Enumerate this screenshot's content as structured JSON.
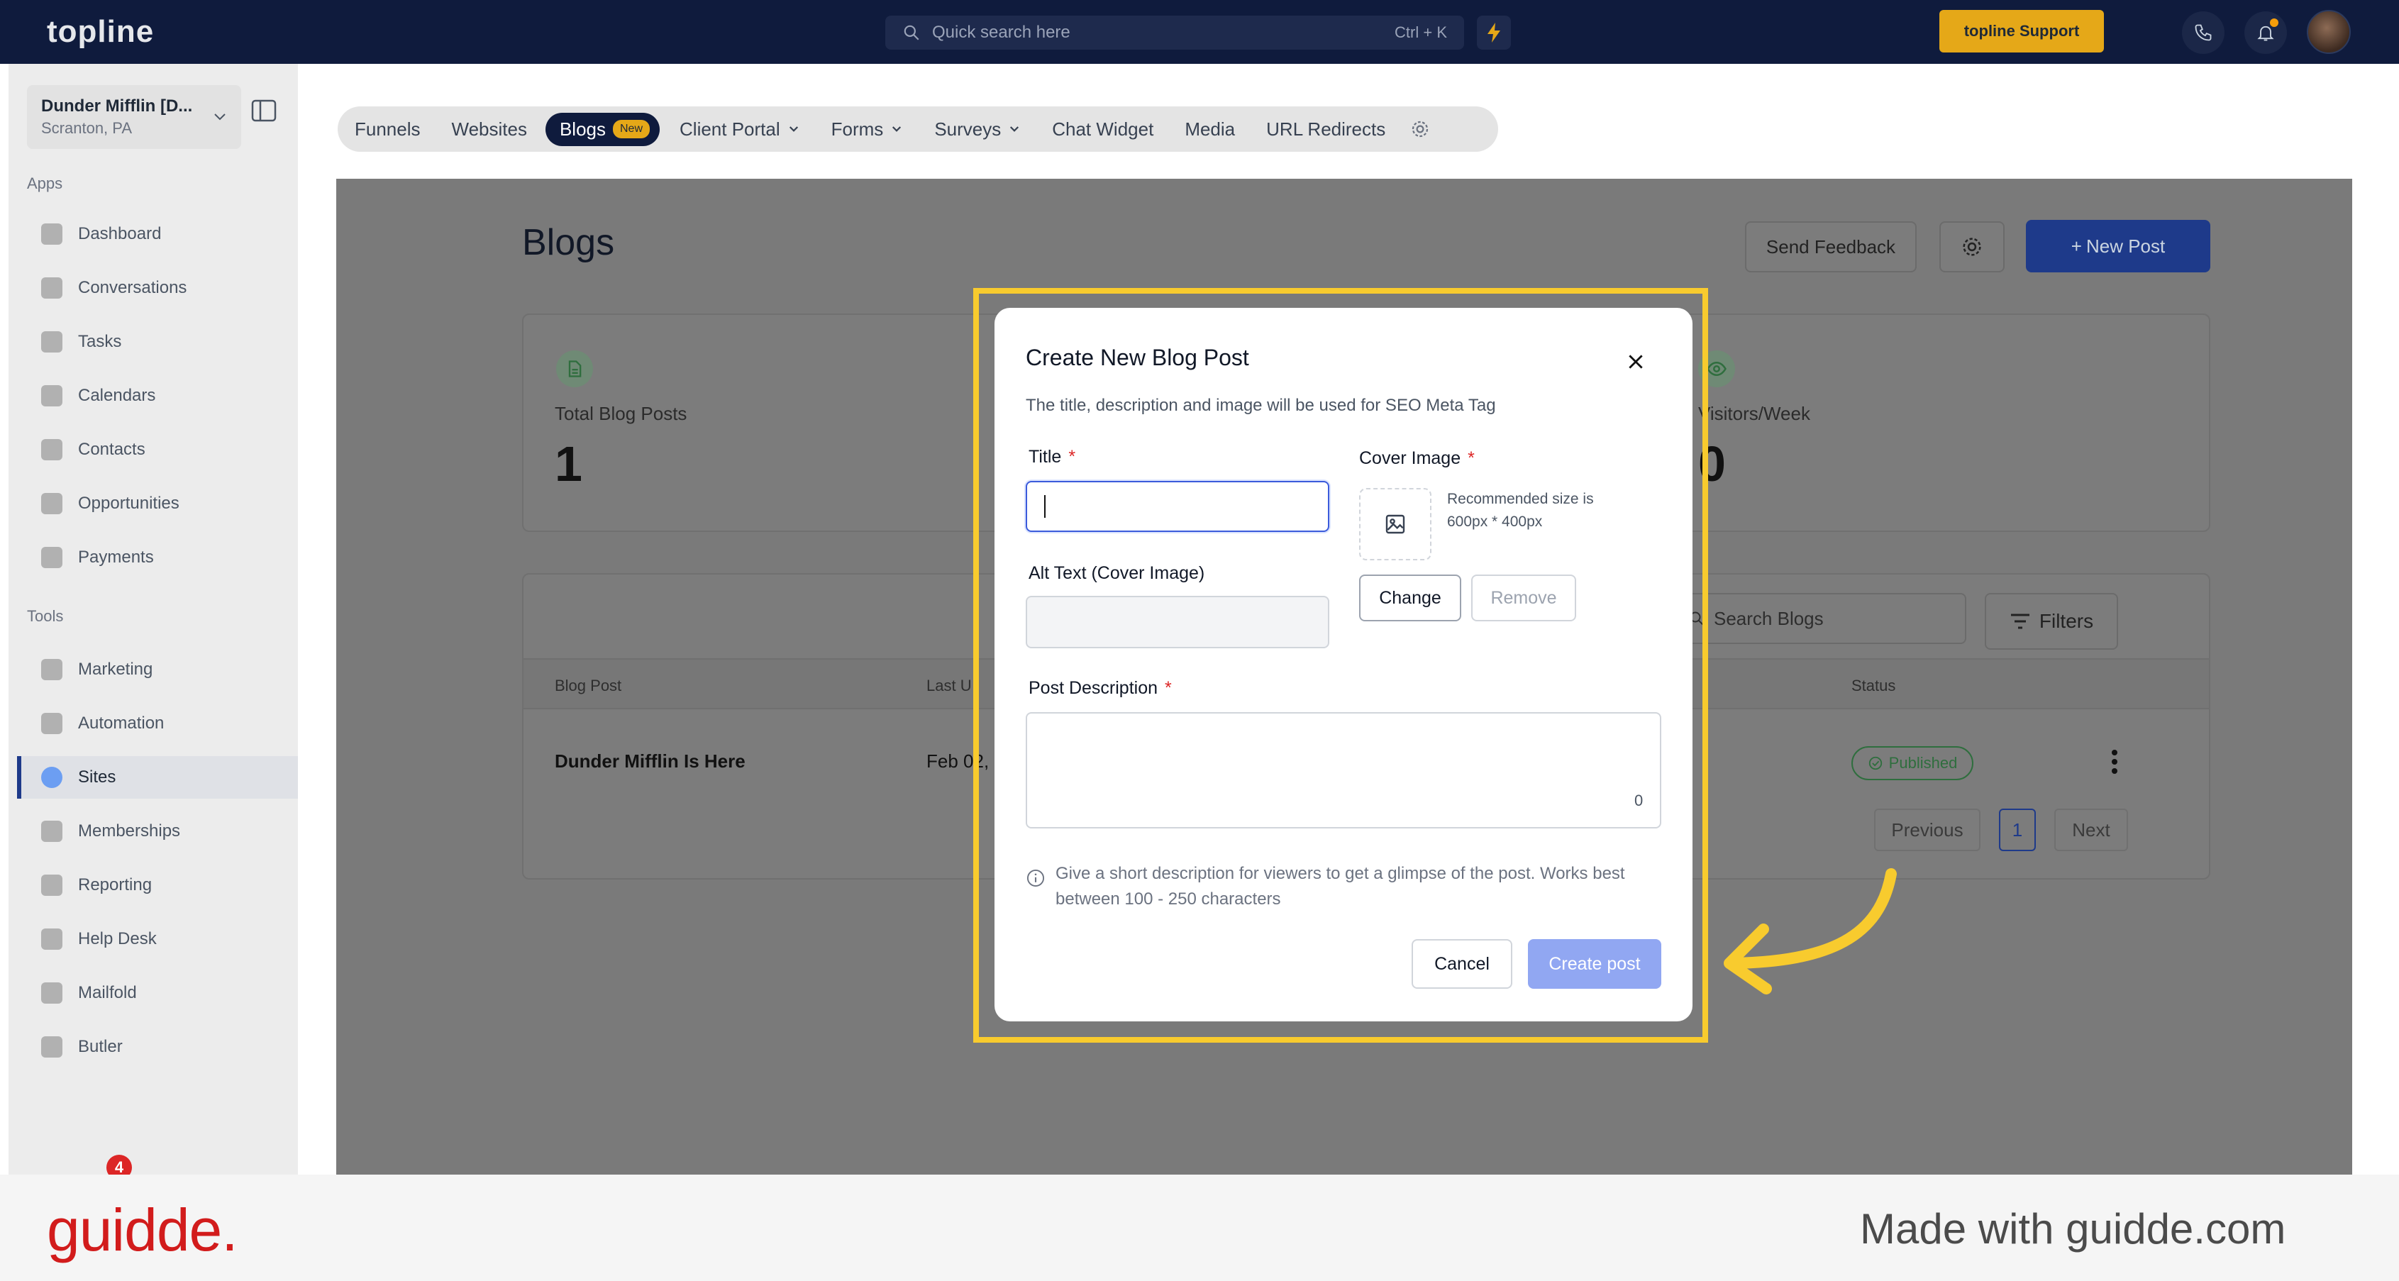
{
  "topbar": {
    "logo": "topline",
    "search_placeholder": "Quick search here",
    "search_shortcut": "Ctrl + K",
    "support_label": "topline Support"
  },
  "sidebar": {
    "location_name": "Dunder Mifflin [D...",
    "location_sub": "Scranton, PA",
    "apps_label": "Apps",
    "apps": [
      "Dashboard",
      "Conversations",
      "Tasks",
      "Calendars",
      "Contacts",
      "Opportunities",
      "Payments"
    ],
    "tools_label": "Tools",
    "tools": [
      "Marketing",
      "Automation",
      "Sites",
      "Memberships",
      "Reporting",
      "Help Desk",
      "Mailfold",
      "Butler"
    ],
    "active_item": "Sites",
    "notification_count": "4"
  },
  "tabs": {
    "items": [
      "Funnels",
      "Websites",
      "Blogs",
      "Client Portal",
      "Forms",
      "Surveys",
      "Chat Widget",
      "Media",
      "URL Redirects"
    ],
    "new_badge": "New"
  },
  "page": {
    "title": "Blogs",
    "send_feedback": "Send Feedback",
    "new_post": "New Post",
    "stats": {
      "total_label": "Total Blog Posts",
      "total_value": "1",
      "visitors_label": "Visitors/Week",
      "visitors_value": "0"
    },
    "search_placeholder": "Search Blogs",
    "filters": "Filters",
    "table": {
      "headers": [
        "Blog Post",
        "Last U",
        "Status"
      ],
      "rows": [
        {
          "post": "Dunder Mifflin Is Here",
          "updated": "Feb 02,",
          "status": "Published"
        }
      ]
    },
    "pagination": {
      "previous": "Previous",
      "current": "1",
      "next": "Next"
    }
  },
  "modal": {
    "title": "Create New Blog Post",
    "subtitle": "The title, description and image will be used for SEO Meta Tag",
    "title_label": "Title",
    "required_mark": "*",
    "title_value": "",
    "cover_label": "Cover Image",
    "recommended": "Recommended size is 600px * 400px",
    "alt_label": "Alt Text (Cover Image)",
    "alt_value": "",
    "change": "Change",
    "remove": "Remove",
    "desc_label": "Post Description",
    "desc_value": "",
    "char_count": "0",
    "hint": "Give a short description for viewers to get a glimpse of the post. Works best between 100 - 250 characters",
    "cancel": "Cancel",
    "create": "Create post"
  },
  "footer": {
    "brand": "guidde.",
    "made_with": "Made with guidde.com"
  },
  "colors": {
    "topbar_bg": "#0f1b3d",
    "accent_blue": "#1e3a8a",
    "highlight": "#f8cb2e",
    "create_btn": "#91a7f2",
    "brand_red": "#d21c1c"
  }
}
